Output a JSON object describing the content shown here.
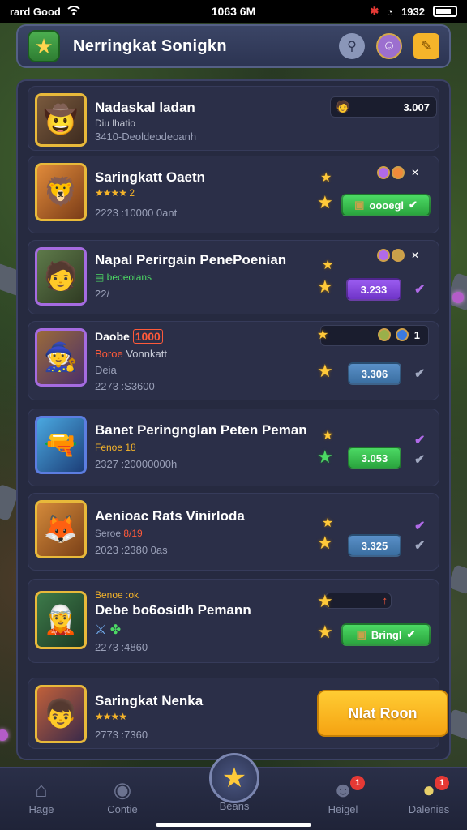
{
  "status_bar": {
    "carrier": "rard Good",
    "time": "1063 6M",
    "battery": "1932"
  },
  "header": {
    "title": "Nerringkat Sonigkn"
  },
  "cards": [
    {
      "name": "Nadaskal ladan",
      "sub": "Diu lhatio",
      "meta": "3410-Deoldeodeoanh",
      "value": "3.007"
    },
    {
      "name": "Saringkatt Oaetn",
      "rating": "★★★★",
      "sub_tail": "2",
      "meta": "2223 :10000 0ant",
      "button": "oooegl"
    },
    {
      "name": "Napal Perirgain PenePoenian",
      "sub": "beoeoians",
      "meta": "22/",
      "button": "3.233"
    },
    {
      "name": "Daobe",
      "name_tag": "1000",
      "sub_red": "Boroe",
      "sub_white": "Vonnkatt",
      "sub2": "Deia",
      "meta": "2273 :S3600",
      "button": "3.306",
      "small_text": "1"
    },
    {
      "name": "Banet Peringnglan Peten Peman",
      "sub": "Fenoe 18",
      "meta": "2327 :20000000h",
      "button": "3.053"
    },
    {
      "name": "Aenioac Rats Vinirloda",
      "sub": "Seroe",
      "sub_tail": "8/19",
      "meta": "2023 :2380 0as",
      "button": "3.325"
    },
    {
      "name": "Debe bo6osidh Pemann",
      "sub": "Benoe :ok",
      "meta": "2273 :4860",
      "button": "Bringl"
    },
    {
      "name": "Saringkat Nenka",
      "rating": "★★★★",
      "meta": "2773 :7360",
      "button": "Nlat Roon"
    }
  ],
  "nav": [
    {
      "label": "Hage"
    },
    {
      "label": "Contie"
    },
    {
      "label": "Beans"
    },
    {
      "label": "Heigel",
      "badge": "1"
    },
    {
      "label": "Dalenies",
      "badge": "1"
    }
  ],
  "colors": {
    "accent_green": "#4cd964",
    "accent_gold": "#f5b42a",
    "panel": "#262a40",
    "purple": "#9b5cf0"
  }
}
